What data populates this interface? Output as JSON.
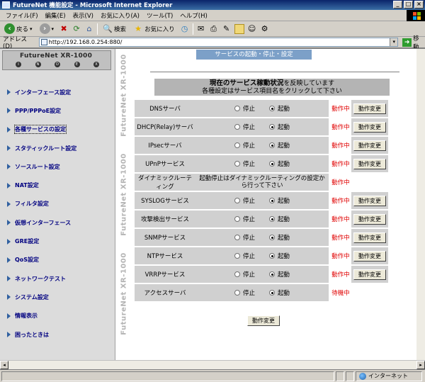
{
  "window": {
    "title": "FutureNet 機能設定 - Microsoft Internet Explorer"
  },
  "menu": [
    "ファイル(F)",
    "編集(E)",
    "表示(V)",
    "お気に入り(A)",
    "ツール(T)",
    "ヘルプ(H)"
  ],
  "toolbar": {
    "back_label": "戻る",
    "search_label": "検索",
    "favorites_label": "お気に入り"
  },
  "address": {
    "label": "アドレス(D)",
    "url": "http://192.168.0.254:880/",
    "go_label": "移動"
  },
  "sidebar": {
    "logo_title": "FutureNet XR-1000",
    "logo_letters": [
      "I",
      "N",
      "D",
      "E",
      "X"
    ],
    "items": [
      {
        "label": "インターフェース設定"
      },
      {
        "label": "PPP/PPPoE設定"
      },
      {
        "label": "各種サービスの設定"
      },
      {
        "label": "スタティックルート設定"
      },
      {
        "label": "ソースルート設定"
      },
      {
        "label": "NAT設定"
      },
      {
        "label": "フィルタ設定"
      },
      {
        "label": "仮想インターフェース"
      },
      {
        "label": "GRE設定"
      },
      {
        "label": "QoS設定"
      },
      {
        "label": "ネットワークテスト"
      },
      {
        "label": "システム設定"
      },
      {
        "label": "情報表示"
      },
      {
        "label": "困ったときは"
      }
    ]
  },
  "brand": {
    "text": "FutureNet XR-1000"
  },
  "main": {
    "title": "サービスの起動・停止・設定",
    "notice_bold": "現在のサービス稼動状況",
    "notice_rest": "を反映しています",
    "notice_line2": "各種設定はサービス項目名をクリックして下さい",
    "stop_label": "停止",
    "start_label": "起動",
    "change_label": "動作変更",
    "services": [
      {
        "name": "DNSサーバ",
        "status": "動作中"
      },
      {
        "name": "DHCP(Relay)サーバ",
        "status": "動作中"
      },
      {
        "name": "IPsecサーバ",
        "status": "動作中"
      },
      {
        "name": "UPnPサービス",
        "status": "動作中"
      },
      {
        "name": "ダイナミックルーティング",
        "status": "動作中",
        "note": "起動停止はダイナミックルーティングの設定から行って下さい"
      },
      {
        "name": "SYSLOGサービス",
        "status": "動作中"
      },
      {
        "name": "攻撃検出サービス",
        "status": "動作中"
      },
      {
        "name": "SNMPサービス",
        "status": "動作中"
      },
      {
        "name": "NTPサービス",
        "status": "動作中"
      },
      {
        "name": "VRRPサービス",
        "status": "動作中"
      },
      {
        "name": "アクセスサーバ",
        "status": "待機中"
      }
    ],
    "submit_label": "動作変更"
  },
  "statusbar": {
    "zone": "インターネット"
  }
}
